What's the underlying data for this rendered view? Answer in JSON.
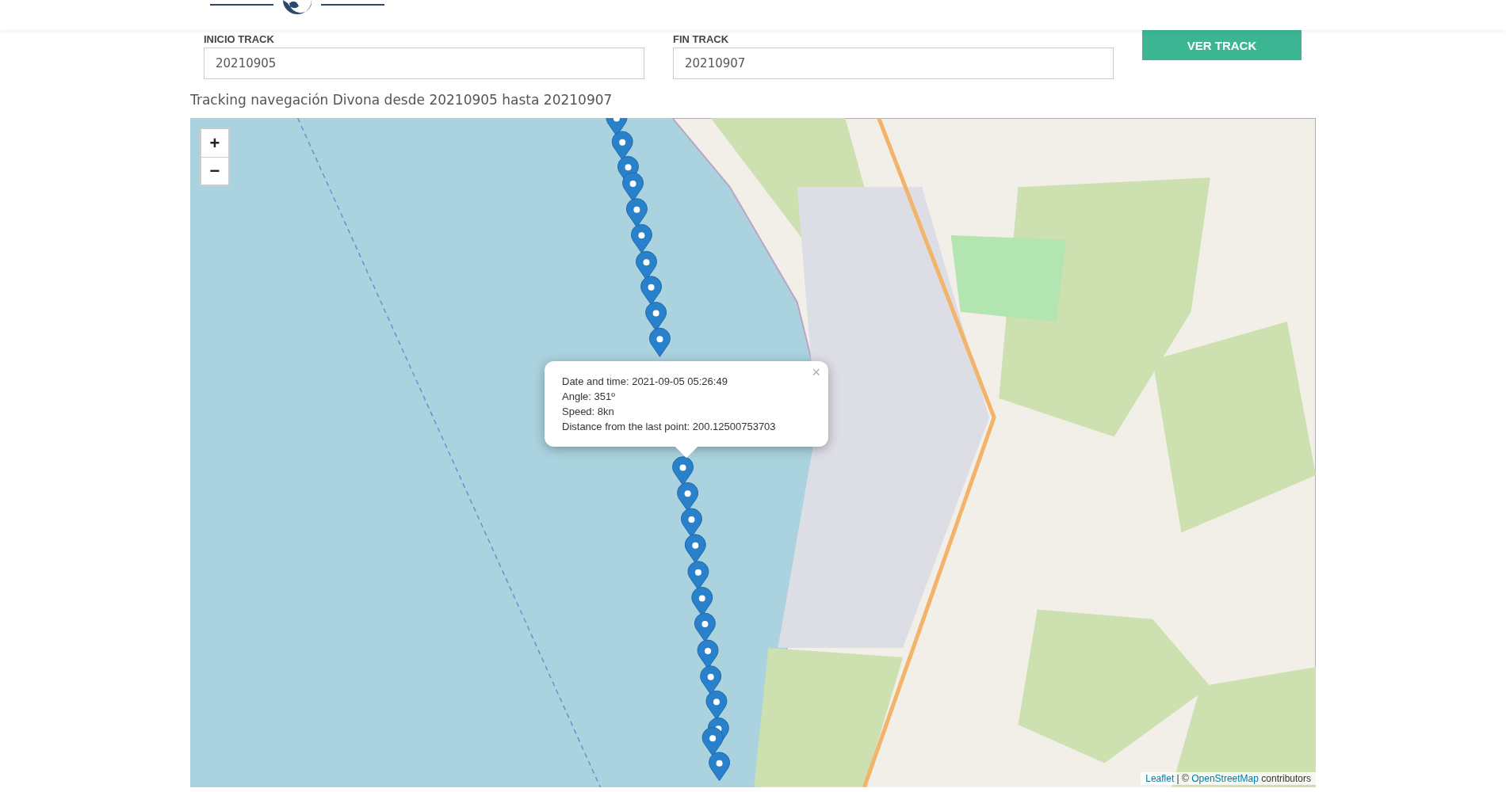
{
  "form": {
    "fields": [
      {
        "label": "INICIO TRACK",
        "value": "20210905"
      },
      {
        "label": "FIN TRACK",
        "value": "20210907"
      }
    ],
    "button": "VER TRACK"
  },
  "caption": "Tracking navegación Divona desde 20210905 hasta 20210907",
  "map": {
    "zoom_in": "+",
    "zoom_out": "−",
    "popup": {
      "close": "×",
      "lines": [
        "Date and time: 2021-09-05 05:26:49",
        "Angle: 351º",
        "Speed: 8kn",
        "Distance from the last point: 200.12500753703"
      ]
    },
    "attribution": [
      {
        "kind": "link",
        "text": "Leaflet"
      },
      {
        "kind": "text",
        "text": " | © "
      },
      {
        "kind": "link",
        "text": "OpenStreetMap"
      },
      {
        "kind": "text",
        "text": " contributors"
      }
    ]
  }
}
